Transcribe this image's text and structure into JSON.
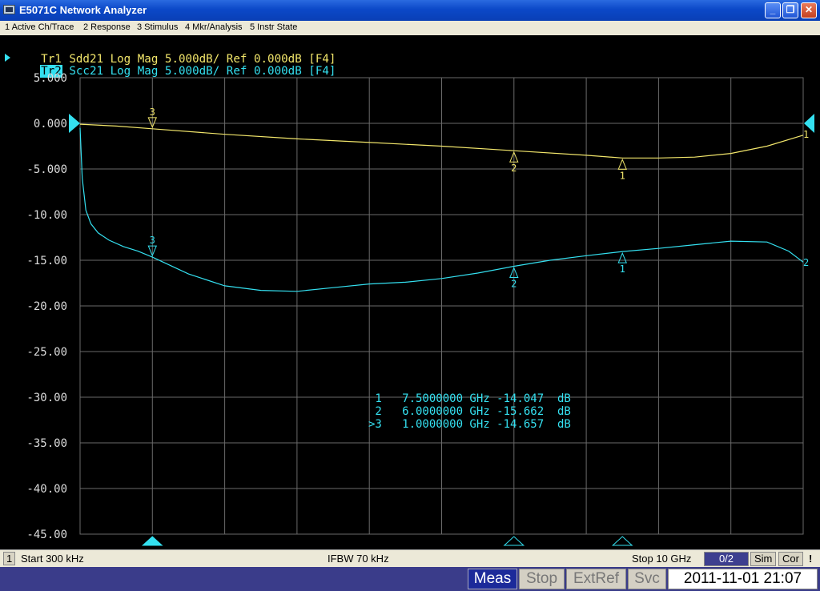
{
  "window": {
    "title": "E5071C Network Analyzer",
    "controls": {
      "minimize": "_",
      "maximize": "❐",
      "close": "✕"
    }
  },
  "menu": [
    "1 Active Ch/Trace",
    "2 Response",
    "3 Stimulus",
    "4 Mkr/Analysis",
    "5 Instr State"
  ],
  "traces": [
    {
      "tag": "Tr1",
      "desc": " Sdd21 Log Mag 5.000dB/ Ref 0.000dB [F4]",
      "color": "#f2e66b"
    },
    {
      "tag": "Tr2",
      "desc": " Scc21 Log Mag 5.000dB/ Ref 0.000dB [F4]",
      "color": "#34e0f0"
    }
  ],
  "colors": {
    "grid": "#6a6a6a",
    "ref_marker": "#34e0f0",
    "ylabels": "#dcdcdc"
  },
  "chart_data": {
    "type": "line",
    "x_unit": "GHz",
    "xlim": [
      0.0003,
      10
    ],
    "ylim": [
      -45,
      5
    ],
    "y_ticks": [
      "5.000",
      "0.000",
      "-5.000",
      "-10.00",
      "-15.00",
      "-20.00",
      "-25.00",
      "-30.00",
      "-35.00",
      "-40.00",
      "-45.00"
    ],
    "grid": true,
    "series": [
      {
        "name": "Sdd21",
        "color": "#f2e66b",
        "x": [
          0.0003,
          0.5,
          1,
          2,
          3,
          4,
          5,
          6,
          7,
          7.5,
          8,
          8.5,
          9,
          9.5,
          10
        ],
        "y": [
          -0.1,
          -0.3,
          -0.6,
          -1.2,
          -1.7,
          -2.1,
          -2.5,
          -3.0,
          -3.5,
          -3.8,
          -3.8,
          -3.7,
          -3.3,
          -2.5,
          -1.3
        ]
      },
      {
        "name": "Scc21",
        "color": "#34e0f0",
        "x": [
          0.0003,
          0.03,
          0.08,
          0.15,
          0.25,
          0.4,
          0.6,
          0.8,
          1,
          1.5,
          2,
          2.5,
          3,
          3.5,
          4,
          4.5,
          5,
          5.5,
          6,
          6.5,
          7,
          7.5,
          8,
          8.5,
          9,
          9.5,
          9.8,
          10
        ],
        "y": [
          -0.5,
          -6.0,
          -9.5,
          -11.0,
          -12.0,
          -12.8,
          -13.5,
          -14.0,
          -14.657,
          -16.5,
          -17.8,
          -18.3,
          -18.4,
          -18.0,
          -17.6,
          -17.4,
          -17.0,
          -16.4,
          -15.662,
          -15.0,
          -14.5,
          -14.047,
          -13.7,
          -13.3,
          -12.9,
          -13.0,
          -14.0,
          -15.2
        ]
      }
    ],
    "markers": [
      {
        "label": "1",
        "x": 7.5
      },
      {
        "label": "2",
        "x": 6
      },
      {
        "label": "3",
        "x": 1
      }
    ],
    "readout": [
      " 1   7.5000000 GHz -14.047  dB",
      " 2   6.0000000 GHz -15.662  dB",
      ">3   1.0000000 GHz -14.657  dB"
    ],
    "end_labels": [
      "1",
      "2"
    ]
  },
  "status": {
    "channel": "1",
    "start": "Start 300 kHz",
    "ifbw": "IFBW 70 kHz",
    "stop": "Stop 10 GHz",
    "avg": "0/2",
    "sim": "Sim",
    "cor": "Cor",
    "flag": "!"
  },
  "bottom": {
    "meas": "Meas",
    "stop": "Stop",
    "extref": "ExtRef",
    "svc": "Svc",
    "datetime": "2011-11-01 21:07"
  }
}
